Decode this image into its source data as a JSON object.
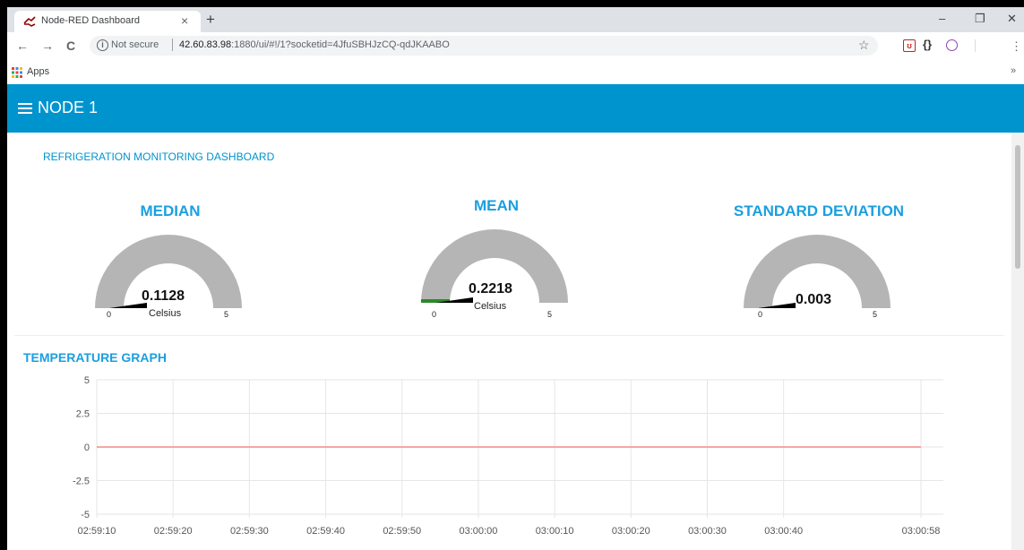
{
  "browser": {
    "tab_title": "Node-RED Dashboard",
    "tab_close": "×",
    "new_tab": "+",
    "minimize": "–",
    "restore": "❐",
    "close": "✕",
    "back": "←",
    "forward": "→",
    "reload": "C",
    "security_label": "Not secure",
    "url_host": "42.60.83.98",
    "url_rest": ":1880/ui/#!/1?socketid=4JfuSBHJzCQ-qdJKAABO",
    "bookmark_star": "☆",
    "bookmarks_apps": "Apps",
    "bookmarks_more": "»",
    "menu": "⋮"
  },
  "dashboard": {
    "title": "NODE 1",
    "group_title": "REFRIGERATION MONITORING DASHBOARD",
    "accent_color": "#0094ce"
  },
  "gauges": [
    {
      "title": "MEDIAN",
      "value": "0.1128",
      "units": "Celsius",
      "min": "0",
      "max": "5",
      "level": 0.02256,
      "needle_color": "#000000"
    },
    {
      "title": "MEAN",
      "value": "0.2218",
      "units": "Celsius",
      "min": "0",
      "max": "5",
      "level": 0.04436,
      "needle_color": "#2a8a2a"
    },
    {
      "title": "STANDARD DEVIATION",
      "value": "0.003",
      "units": "",
      "min": "0",
      "max": "5",
      "level": 0.0006,
      "needle_color": "#000000"
    }
  ],
  "chart_title": "TEMPERATURE GRAPH",
  "chart_data": {
    "type": "line",
    "title": "TEMPERATURE GRAPH",
    "xlabel": "",
    "ylabel": "",
    "x_ticks": [
      "02:59:10",
      "02:59:20",
      "02:59:30",
      "02:59:40",
      "02:59:50",
      "03:00:00",
      "03:00:10",
      "03:00:20",
      "03:00:30",
      "03:00:40",
      "03:00:58"
    ],
    "y_ticks": [
      "5",
      "2.5",
      "0",
      "-2.5",
      "-5"
    ],
    "ylim": [
      -5,
      5
    ],
    "grid": true,
    "series": [
      {
        "color": "#f4a6a6",
        "x": [
          "02:59:10",
          "03:00:58"
        ],
        "values": [
          0,
          0
        ]
      }
    ]
  }
}
